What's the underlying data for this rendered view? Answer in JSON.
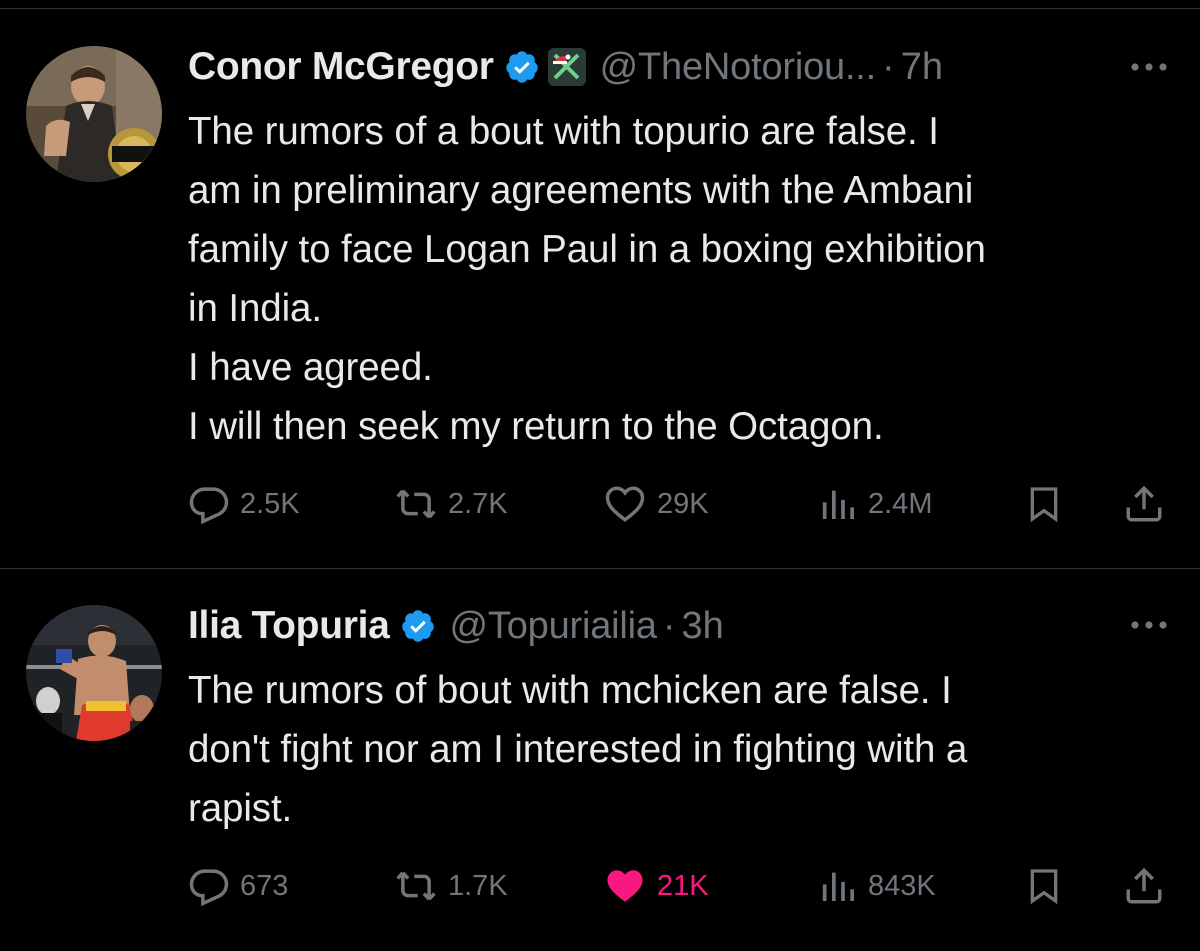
{
  "tweets": [
    {
      "author_name": "Conor McGregor",
      "handle": "@TheNotoriou...",
      "separator": "·",
      "time": "7h",
      "text": "The rumors of a bout with topurio are false. I\nam in preliminary agreements with the Ambani\nfamily to face Logan Paul in a boxing exhibition\nin India.\nI have agreed.\nI will then seek my return to the Octagon.",
      "replies": "2.5K",
      "reposts": "2.7K",
      "likes": "29K",
      "views": "2.4M",
      "liked": false,
      "icons": {
        "verified": "verified-badge-icon",
        "affiliate": "affiliate-badge-icon",
        "more": "more-options-icon",
        "reply": "reply-icon",
        "repost": "repost-icon",
        "like": "heart-icon",
        "views": "views-chart-icon",
        "bookmark": "bookmark-icon",
        "share": "share-icon"
      }
    },
    {
      "author_name": "Ilia Topuria",
      "handle": "@Topuriailia",
      "separator": "·",
      "time": "3h",
      "text": "The rumors of bout with mchicken are false. I\ndon't fight nor am I interested in fighting with a\nrapist.",
      "replies": "673",
      "reposts": "1.7K",
      "likes": "21K",
      "views": "843K",
      "liked": true,
      "icons": {
        "verified": "verified-badge-icon",
        "more": "more-options-icon",
        "reply": "reply-icon",
        "repost": "repost-icon",
        "like": "heart-filled-icon",
        "views": "views-chart-icon",
        "bookmark": "bookmark-icon",
        "share": "share-icon"
      }
    }
  ],
  "colors": {
    "background": "#000000",
    "text_primary": "#e7e9ea",
    "text_secondary": "#71767b",
    "verified_blue": "#1d9bf0",
    "like_pink": "#f91880",
    "divider": "#2f3336"
  }
}
